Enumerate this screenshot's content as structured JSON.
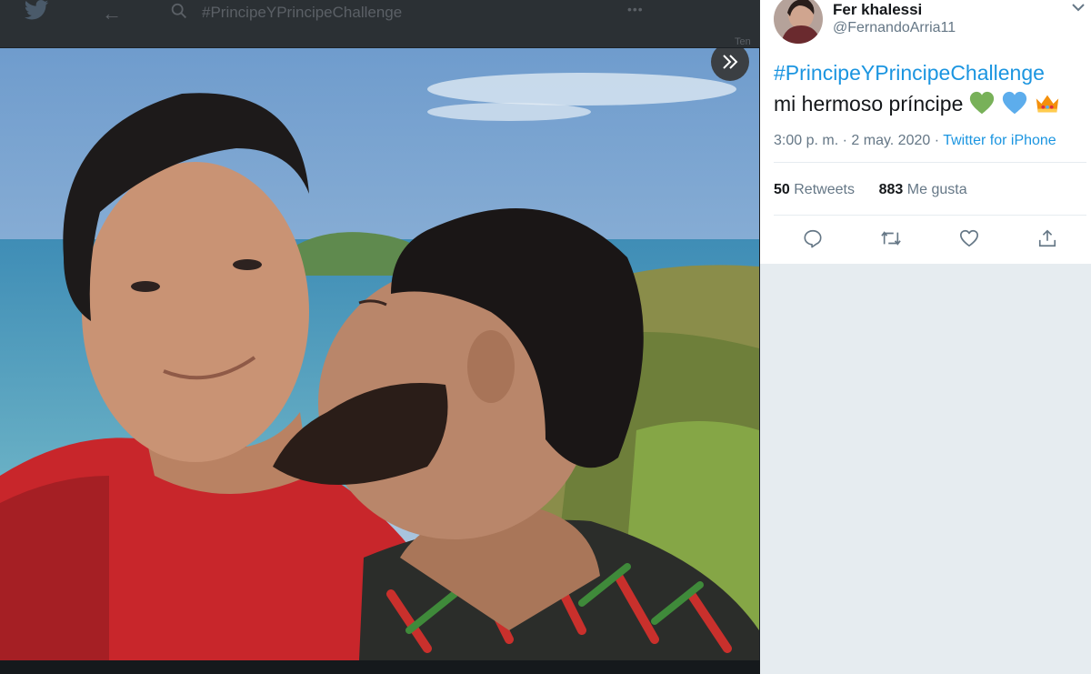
{
  "background": {
    "search_query": "#PrincipeYPrincipeChallenge",
    "side_text": "Ten",
    "icons": [
      "twitter-bird-icon",
      "back-arrow-icon",
      "search-icon",
      "more-icon"
    ]
  },
  "viewer": {
    "collapse_icon": "double-chevron-right-icon"
  },
  "tweet": {
    "display_name": "Fer khalessi",
    "handle": "@FernandoArria11",
    "hashtag": "#PrincipeYPrincipeChallenge",
    "text": "mi hermoso príncipe",
    "emojis": [
      "green-heart",
      "blue-heart",
      "crown"
    ],
    "time": "3:00 p. m.",
    "separator": "·",
    "date": "2 may. 2020",
    "source": "Twitter for iPhone",
    "retweets_count": "50",
    "retweets_label": "Retweets",
    "likes_count": "883",
    "likes_label": "Me gusta",
    "actions": [
      "reply-icon",
      "retweet-icon",
      "like-icon",
      "share-icon"
    ]
  },
  "colors": {
    "link": "#1b95e0",
    "text": "#14171a",
    "muted": "#657786",
    "divider": "#e6ecf0"
  }
}
